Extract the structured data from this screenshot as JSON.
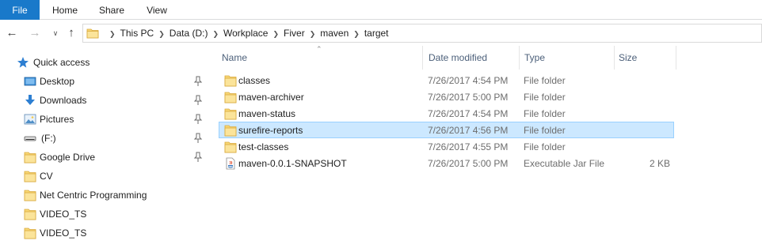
{
  "ribbon": {
    "tabs": [
      "File",
      "Home",
      "Share",
      "View"
    ]
  },
  "address": {
    "crumbs": [
      "This PC",
      "Data (D:)",
      "Workplace",
      "Fiver",
      "maven",
      "target"
    ]
  },
  "nav": {
    "quick_access": "Quick access",
    "items": [
      {
        "label": "Desktop",
        "icon": "desktop-icon",
        "pinned": true
      },
      {
        "label": "Downloads",
        "icon": "downloads-icon",
        "pinned": true
      },
      {
        "label": "Pictures",
        "icon": "pictures-icon",
        "pinned": true
      },
      {
        "label": "(F:)",
        "icon": "drive-icon",
        "pinned": true
      },
      {
        "label": "Google Drive",
        "icon": "folder-icon",
        "pinned": true
      },
      {
        "label": "CV",
        "icon": "folder-icon",
        "pinned": false
      },
      {
        "label": "Net Centric Programming",
        "icon": "folder-icon",
        "pinned": false
      },
      {
        "label": "VIDEO_TS",
        "icon": "folder-icon",
        "pinned": false
      },
      {
        "label": "VIDEO_TS",
        "icon": "folder-icon",
        "pinned": false
      }
    ]
  },
  "columns": {
    "name": "Name",
    "date": "Date modified",
    "type": "Type",
    "size": "Size"
  },
  "files": [
    {
      "name": "classes",
      "date": "7/26/2017 4:54 PM",
      "type": "File folder",
      "size": "",
      "icon": "folder-icon"
    },
    {
      "name": "maven-archiver",
      "date": "7/26/2017 5:00 PM",
      "type": "File folder",
      "size": "",
      "icon": "folder-icon"
    },
    {
      "name": "maven-status",
      "date": "7/26/2017 4:54 PM",
      "type": "File folder",
      "size": "",
      "icon": "folder-icon"
    },
    {
      "name": "surefire-reports",
      "date": "7/26/2017 4:56 PM",
      "type": "File folder",
      "size": "",
      "icon": "folder-icon",
      "selected": true
    },
    {
      "name": "test-classes",
      "date": "7/26/2017 4:55 PM",
      "type": "File folder",
      "size": "",
      "icon": "folder-icon"
    },
    {
      "name": "maven-0.0.1-SNAPSHOT",
      "date": "7/26/2017 5:00 PM",
      "type": "Executable Jar File",
      "size": "2 KB",
      "icon": "jar-file-icon"
    }
  ],
  "colors": {
    "accent": "#1979ca",
    "selection": "#cce8ff",
    "selection_border": "#99d1ff",
    "folder": "#f8d775",
    "header_text": "#4c607a"
  }
}
